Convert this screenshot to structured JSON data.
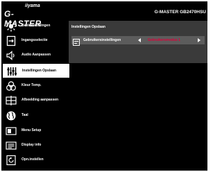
{
  "header": {
    "brand_small": "iiyama",
    "brand_big": "G-MASTER",
    "model": "G-MASTER GB2470HSU"
  },
  "sidebar": {
    "items": [
      {
        "label": "Beeldinstellingen",
        "icon": "picture-settings-icon"
      },
      {
        "label": "Ingangsselectie",
        "icon": "input-select-icon"
      },
      {
        "label": "Audio Aanpassen",
        "icon": "speaker-icon"
      },
      {
        "label": "Instellingen Opslaan",
        "icon": "save-settings-icon",
        "active": true
      },
      {
        "label": "Kleur Temp.",
        "icon": "color-temp-icon"
      },
      {
        "label": "Afbeelding aanpassen",
        "icon": "image-adjust-icon"
      },
      {
        "label": "Taal",
        "icon": "globe-icon"
      },
      {
        "label": "Menu Setup",
        "icon": "menu-setup-icon"
      },
      {
        "label": "Display info",
        "icon": "display-info-icon"
      },
      {
        "label": "Opn.instellen",
        "icon": "reset-icon"
      }
    ]
  },
  "content": {
    "title": "Instellingen Opslaan",
    "row": {
      "label": "Gebruikersinstellingen",
      "value": "Gebruikersmodus 1",
      "icon": "user-settings-icon"
    }
  },
  "colors": {
    "background": "#000000",
    "panel": "#3a3a3a",
    "row": "#5c5c5c",
    "accent": "#e0003a"
  }
}
